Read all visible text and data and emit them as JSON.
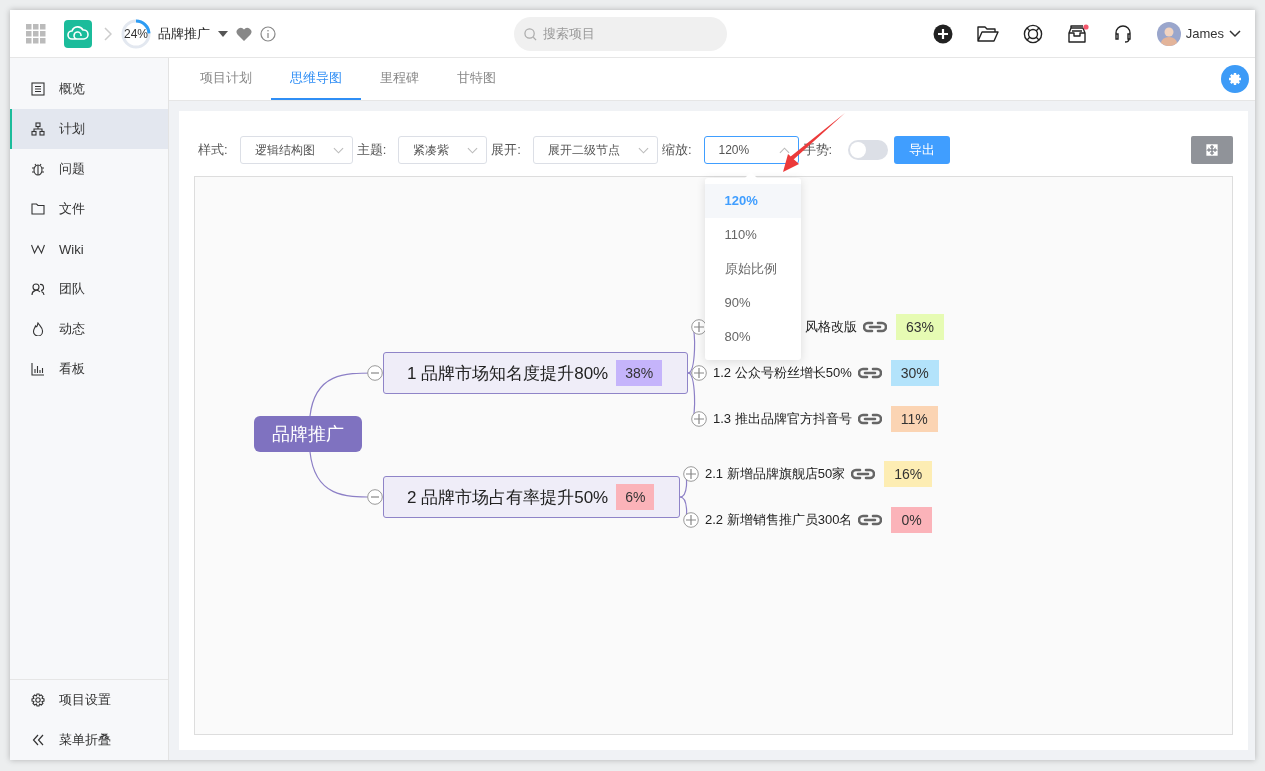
{
  "topbar": {
    "progress": {
      "label": "24%",
      "level": 0.24
    },
    "project": "品牌推广",
    "search": {
      "placeholder": "搜索项目"
    },
    "inbox_unread": true,
    "user": "James"
  },
  "sidebar": {
    "items": [
      {
        "label": "概览",
        "selected": false
      },
      {
        "label": "计划",
        "selected": true
      },
      {
        "label": "问题",
        "selected": false
      },
      {
        "label": "文件",
        "selected": false
      },
      {
        "label": "Wiki",
        "selected": false
      },
      {
        "label": "团队",
        "selected": false
      },
      {
        "label": "动态",
        "selected": false
      },
      {
        "label": "看板",
        "selected": false
      }
    ],
    "footer": [
      {
        "label": "项目设置"
      },
      {
        "label": "菜单折叠"
      }
    ]
  },
  "tabs": [
    {
      "label": "项目计划",
      "selected": false
    },
    {
      "label": "思维导图",
      "selected": true
    },
    {
      "label": "里程碑",
      "selected": false
    },
    {
      "label": "甘特图",
      "selected": false
    }
  ],
  "toolbar": {
    "controls": [
      {
        "kind": "select",
        "label": "样式:",
        "value": "逻辑结构图",
        "open": false
      },
      {
        "kind": "select",
        "label": "主题:",
        "value": "紧凑紫",
        "open": false
      },
      {
        "kind": "select",
        "label": "展开:",
        "value": "展开二级节点",
        "open": false
      },
      {
        "kind": "select",
        "label": "缩放:",
        "value": "120%",
        "open": true,
        "options": [
          {
            "label": "120%",
            "selected": true
          },
          {
            "label": "110%",
            "selected": false
          },
          {
            "label": "原始比例",
            "selected": false
          },
          {
            "label": "90%",
            "selected": false
          },
          {
            "label": "80%",
            "selected": false
          }
        ]
      },
      {
        "kind": "toggle",
        "label": "手势:",
        "on": false
      },
      {
        "kind": "button",
        "label": "导出"
      }
    ]
  },
  "mindmap": {
    "root": "品牌推广",
    "branches": [
      {
        "title": "1 品牌市场知名度提升80%",
        "progress": "38%",
        "color": "#c5b4fb",
        "expanded": true,
        "children": [
          {
            "title": "风格改版",
            "progress": "63%",
            "color": "#e6fbb3",
            "covered": true
          },
          {
            "title": "1.2 公众号粉丝增长50%",
            "progress": "30%",
            "color": "#b3e3fb",
            "covered": false
          },
          {
            "title": "1.3 推出品牌官方抖音号",
            "progress": "11%",
            "color": "#fbd4b3",
            "covered": false
          }
        ]
      },
      {
        "title": "2 品牌市场占有率提升50%",
        "progress": "6%",
        "color": "#fbb3b9",
        "expanded": true,
        "children": [
          {
            "title": "2.1 新增品牌旗舰店50家",
            "progress": "16%",
            "color": "#fdedb3",
            "covered": false
          },
          {
            "title": "2.2 新增销售推广员300名",
            "progress": "0%",
            "color": "#fbb3b9",
            "covered": false
          }
        ]
      }
    ]
  }
}
